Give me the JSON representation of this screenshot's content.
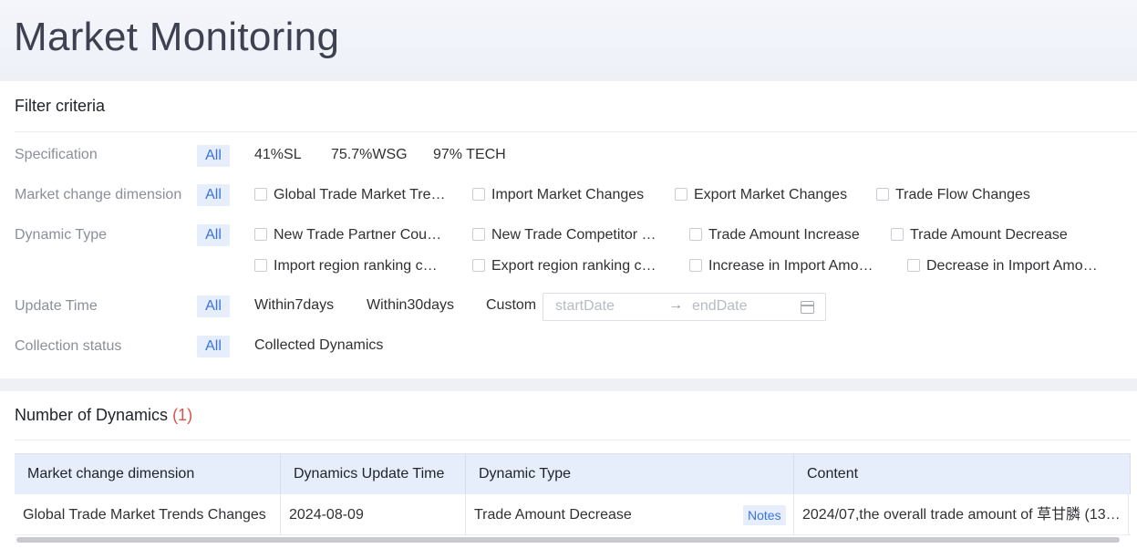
{
  "page": {
    "title": "Market Monitoring"
  },
  "filters": {
    "title": "Filter criteria",
    "all_label": "All",
    "specification": {
      "label": "Specification",
      "options": [
        "41%SL",
        "75.7%WSG",
        "97% TECH"
      ]
    },
    "market_change_dimension": {
      "label": "Market change dimension",
      "options": [
        "Global Trade Market Tre…",
        "Import Market Changes",
        "Export Market Changes",
        "Trade Flow Changes"
      ]
    },
    "dynamic_type": {
      "label": "Dynamic Type",
      "options": [
        "New Trade Partner Cou…",
        "New Trade Competitor …",
        "Trade Amount Increase",
        "Trade Amount Decrease",
        "Import region ranking c…",
        "Export region ranking c…",
        "Increase in Import Amo…",
        "Decrease in Import Amo…"
      ]
    },
    "update_time": {
      "label": "Update Time",
      "options": [
        "Within7days",
        "Within30days",
        "Custom"
      ],
      "start_placeholder": "startDate",
      "end_placeholder": "endDate",
      "range_separator": "→"
    },
    "collection_status": {
      "label": "Collection status",
      "options": [
        "Collected Dynamics"
      ]
    }
  },
  "dynamics": {
    "title": "Number of Dynamics",
    "count_text": "(1)",
    "columns": [
      "Market change dimension",
      "Dynamics Update Time",
      "Dynamic Type",
      "Content"
    ],
    "rows": [
      {
        "dimension": "Global Trade Market Trends Changes",
        "update_time": "2024-08-09",
        "type": "Trade Amount Decrease",
        "notes_label": "Notes",
        "content": "2024/07,the overall trade amount of 草甘膦 (137…"
      }
    ]
  },
  "colors": {
    "accent": "#3a73e0",
    "accent_bg": "#e6eefc",
    "count": "#d9534f",
    "header_bg": "#e6edfb"
  }
}
